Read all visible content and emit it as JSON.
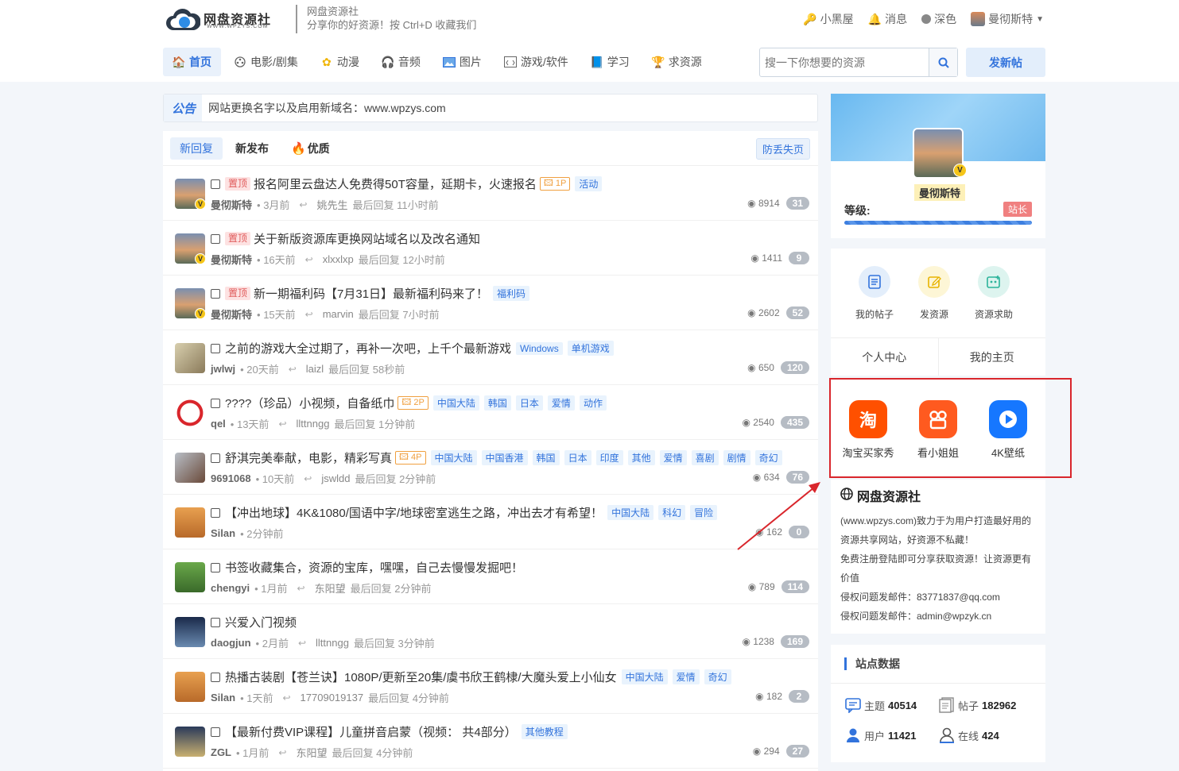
{
  "site": {
    "name": "网盘资源社",
    "domain": "WWW.WPZYS.COM",
    "slogan_title": "网盘资源社",
    "slogan_sub": "分享你的好资源！按 Ctrl+D 收藏我们"
  },
  "topbar": {
    "blackroom": "小黑屋",
    "messages": "消息",
    "dark": "深色",
    "username": "曼彻斯特"
  },
  "nav": {
    "items": [
      "首页",
      "电影/剧集",
      "动漫",
      "音频",
      "图片",
      "游戏/软件",
      "学习",
      "求资源"
    ]
  },
  "search": {
    "placeholder": "搜一下你想要的资源"
  },
  "post_button": "发新帖",
  "notice": {
    "label": "公告",
    "text": "网站更换名字以及启用新域名：www.wpzys.com"
  },
  "tabs": {
    "new_reply": "新回复",
    "new_post": "新发布",
    "quality": "优质",
    "backup": "防丢失页"
  },
  "threads": [
    {
      "pin": "置顶",
      "title": "报名阿里云盘达人免费得50T容量，延期卡，火速报名",
      "img": "1P",
      "tags": [
        "活动"
      ],
      "user": "曼彻斯特",
      "time": "3月前",
      "last_user": "姚先生",
      "last": "最后回复 11小时前",
      "views": "8914",
      "replies": "31"
    },
    {
      "pin": "置顶",
      "title": "关于新版资源库更换网站域名以及改名通知",
      "img": "",
      "tags": [],
      "user": "曼彻斯特",
      "time": "16天前",
      "last_user": "xlxxlxp",
      "last": "最后回复 12小时前",
      "views": "1411",
      "replies": "9"
    },
    {
      "pin": "置顶",
      "title": "新一期福利码【7月31日】最新福利码来了！",
      "img": "",
      "tags": [
        "福利码"
      ],
      "user": "曼彻斯特",
      "time": "15天前",
      "last_user": "marvin",
      "last": "最后回复 7小时前",
      "views": "2602",
      "replies": "52"
    },
    {
      "pin": "",
      "title": "之前的游戏大全过期了，再补一次吧，上千个最新游戏",
      "img": "",
      "tags": [
        "Windows",
        "单机游戏"
      ],
      "user": "jwlwj",
      "time": "20天前",
      "last_user": "laizl",
      "last": "最后回复 58秒前",
      "views": "650",
      "replies": "120"
    },
    {
      "pin": "",
      "title": "????（珍品）小视频，自备纸巾",
      "img": "2P",
      "tags": [
        "中国大陆",
        "韩国",
        "日本",
        "爱情",
        "动作"
      ],
      "user": "qel",
      "time": "13天前",
      "last_user": "llttnngg",
      "last": "最后回复 1分钟前",
      "views": "2540",
      "replies": "435"
    },
    {
      "pin": "",
      "title": "舒淇完美奉献，电影，精彩写真",
      "img": "4P",
      "tags": [
        "中国大陆",
        "中国香港",
        "韩国",
        "日本",
        "印度",
        "其他",
        "爱情",
        "喜剧",
        "剧情",
        "奇幻"
      ],
      "user": "9691068",
      "time": "10天前",
      "last_user": "jswldd",
      "last": "最后回复 2分钟前",
      "views": "634",
      "replies": "76"
    },
    {
      "pin": "",
      "title": "【冲出地球】4K&1080/国语中字/地球密室逃生之路，冲出去才有希望！",
      "img": "",
      "tags": [
        "中国大陆",
        "科幻",
        "冒险"
      ],
      "user": "Silan",
      "time": "2分钟前",
      "last_user": "",
      "last": "",
      "views": "162",
      "replies": "0"
    },
    {
      "pin": "",
      "title": "书签收藏集合，资源的宝库，嘿嘿，自己去慢慢发掘吧！",
      "img": "",
      "tags": [],
      "user": "chengyi",
      "time": "1月前",
      "last_user": "东阳望",
      "last": "最后回复 2分钟前",
      "views": "789",
      "replies": "114"
    },
    {
      "pin": "",
      "title": "兴爱入门视频",
      "img": "",
      "tags": [],
      "user": "daogjun",
      "time": "2月前",
      "last_user": "llttnngg",
      "last": "最后回复 3分钟前",
      "views": "1238",
      "replies": "169"
    },
    {
      "pin": "",
      "title": "热播古装剧【苍兰诀】1080P/更新至20集/虞书欣王鹤棣/大魔头爱上小仙女",
      "img": "",
      "tags": [
        "中国大陆",
        "爱情",
        "奇幻"
      ],
      "user": "Silan",
      "time": "1天前",
      "last_user": "17709019137",
      "last": "最后回复 4分钟前",
      "views": "182",
      "replies": "2"
    },
    {
      "pin": "",
      "title": "【最新付费VIP课程】儿童拼音启蒙（视频： 共4部分）",
      "img": "",
      "tags": [
        "其他教程"
      ],
      "user": "ZGL",
      "time": "1月前",
      "last_user": "东阳望",
      "last": "最后回复 4分钟前",
      "views": "294",
      "replies": "27"
    }
  ],
  "profile": {
    "name": "曼彻斯特",
    "level_label": "等级:",
    "badge": "站长"
  },
  "quick": {
    "my_posts": "我的帖子",
    "post_resource": "发资源",
    "request": "资源求助",
    "center": "个人中心",
    "home": "我的主页"
  },
  "apps": {
    "taobao": "淘宝买家秀",
    "xiaojiejie": "看小姐姐",
    "wallpaper": "4K壁纸",
    "taobao_glyph": "淘"
  },
  "about": {
    "title": "网盘资源社",
    "p1": "(www.wpzys.com)致力于为用户打造最好用的资源共享网站，好资源不私藏！",
    "p2": "免费注册登陆即可分享获取资源！让资源更有价值",
    "p3": "侵权问题发邮件：83771837@qq.com",
    "p4": "侵权问题发邮件：admin@wpzyk.cn"
  },
  "sitedata": {
    "title": "站点数据",
    "topics_label": "主题",
    "topics": "40514",
    "posts_label": "帖子",
    "posts": "182962",
    "users_label": "用户",
    "users": "11421",
    "online_label": "在线",
    "online": "424"
  },
  "colors": {
    "accent": "#3273dc",
    "annotation": "#d9262c"
  }
}
